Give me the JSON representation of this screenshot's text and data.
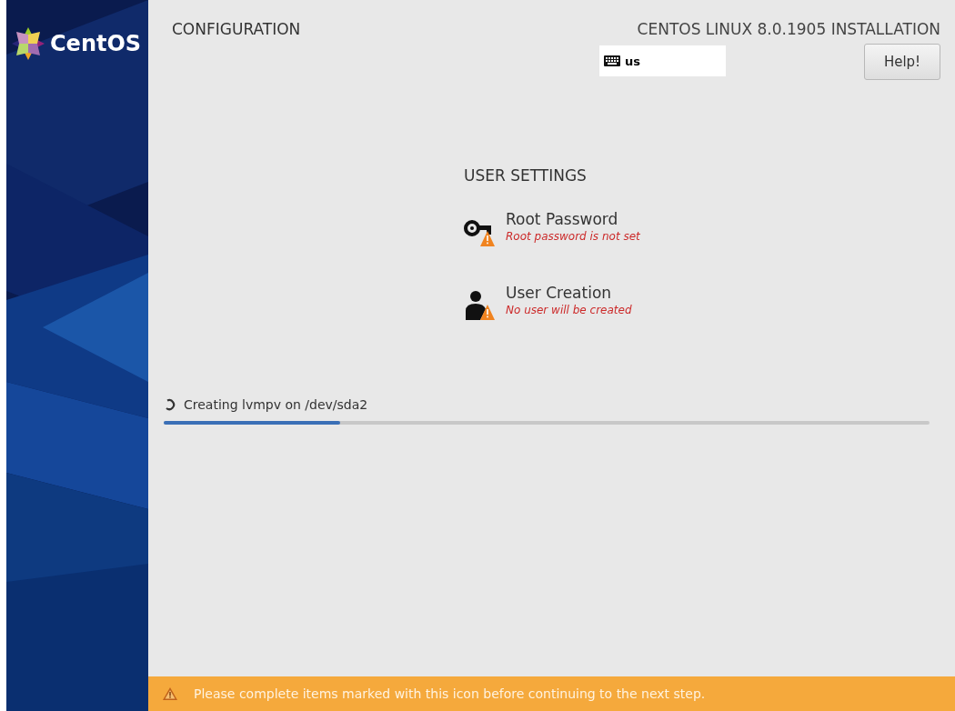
{
  "sidebar": {
    "logo_text": "CentOS"
  },
  "header": {
    "title": "CONFIGURATION",
    "product": "CENTOS LINUX 8.0.1905 INSTALLATION",
    "keyboard_layout": "us",
    "help_button": "Help!"
  },
  "section": {
    "title": "USER SETTINGS",
    "items": [
      {
        "kind": "key",
        "title": "Root Password",
        "status": "Root password is not set",
        "warning": true
      },
      {
        "kind": "user",
        "title": "User Creation",
        "status": "No user will be created",
        "warning": true
      }
    ]
  },
  "progress": {
    "label": "Creating lvmpv on /dev/sda2",
    "level": 0.23
  },
  "warning_bar": {
    "text": "Please complete items marked with this icon before continuing to the next step."
  }
}
